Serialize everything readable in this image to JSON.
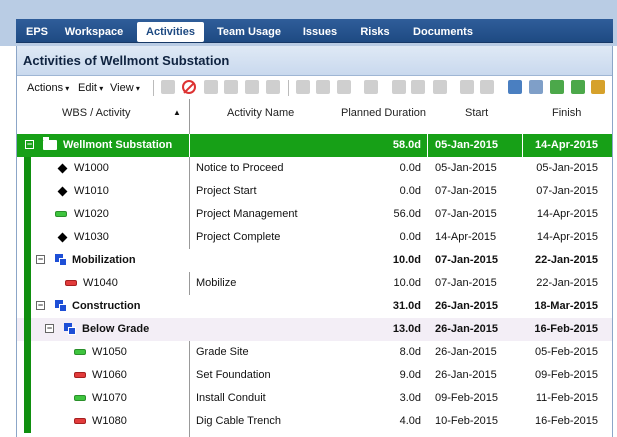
{
  "nav": {
    "tabs": [
      {
        "label": "EPS"
      },
      {
        "label": "Workspace"
      },
      {
        "label": "Activities"
      },
      {
        "label": "Team Usage"
      },
      {
        "label": "Issues"
      },
      {
        "label": "Risks"
      },
      {
        "label": "Documents"
      }
    ],
    "active_tab": "Activities"
  },
  "panel": {
    "title": "Activities of Wellmont Substation"
  },
  "toolbar": {
    "menus": [
      {
        "label": "Actions"
      },
      {
        "label": "Edit"
      },
      {
        "label": "View"
      }
    ]
  },
  "columns": {
    "wbs": "WBS / Activity",
    "name": "Activity Name",
    "duration": "Planned Duration",
    "start": "Start",
    "finish": "Finish"
  },
  "rows": [
    {
      "kind": "project",
      "id": "Wellmont Substation",
      "name": "",
      "duration": "58.0d",
      "start": "05-Jan-2015",
      "finish": "14-Apr-2015"
    },
    {
      "kind": "milestone",
      "id": "W1000",
      "name": "Notice to Proceed",
      "duration": "0.0d",
      "start": "05-Jan-2015",
      "finish": "05-Jan-2015"
    },
    {
      "kind": "milestone",
      "id": "W1010",
      "name": "Project Start",
      "duration": "0.0d",
      "start": "07-Jan-2015",
      "finish": "07-Jan-2015"
    },
    {
      "kind": "task-green",
      "id": "W1020",
      "name": "Project Management",
      "duration": "56.0d",
      "start": "07-Jan-2015",
      "finish": "14-Apr-2015"
    },
    {
      "kind": "milestone",
      "id": "W1030",
      "name": "Project Complete",
      "duration": "0.0d",
      "start": "14-Apr-2015",
      "finish": "14-Apr-2015"
    },
    {
      "kind": "wbs",
      "id": "Mobilization",
      "name": "",
      "duration": "10.0d",
      "start": "07-Jan-2015",
      "finish": "22-Jan-2015"
    },
    {
      "kind": "task-red",
      "id": "W1040",
      "name": "Mobilize",
      "duration": "10.0d",
      "start": "07-Jan-2015",
      "finish": "22-Jan-2015"
    },
    {
      "kind": "wbs",
      "id": "Construction",
      "name": "",
      "duration": "31.0d",
      "start": "26-Jan-2015",
      "finish": "18-Mar-2015"
    },
    {
      "kind": "wbs2",
      "id": "Below Grade",
      "name": "",
      "duration": "13.0d",
      "start": "26-Jan-2015",
      "finish": "16-Feb-2015"
    },
    {
      "kind": "task-green",
      "id": "W1050",
      "name": "Grade Site",
      "duration": "8.0d",
      "start": "26-Jan-2015",
      "finish": "05-Feb-2015"
    },
    {
      "kind": "task-red",
      "id": "W1060",
      "name": "Set Foundation",
      "duration": "9.0d",
      "start": "26-Jan-2015",
      "finish": "09-Feb-2015"
    },
    {
      "kind": "task-green",
      "id": "W1070",
      "name": "Install Conduit",
      "duration": "3.0d",
      "start": "09-Feb-2015",
      "finish": "11-Feb-2015"
    },
    {
      "kind": "task-red",
      "id": "W1080",
      "name": "Dig Cable Trench",
      "duration": "4.0d",
      "start": "10-Feb-2015",
      "finish": "16-Feb-2015"
    }
  ],
  "colors": {
    "nav_bar": "#1e4a82",
    "project_row": "#17a017",
    "wbs_icon": "#1e4fd6",
    "task_green": "#3ec43e",
    "task_red": "#e23b3b"
  }
}
